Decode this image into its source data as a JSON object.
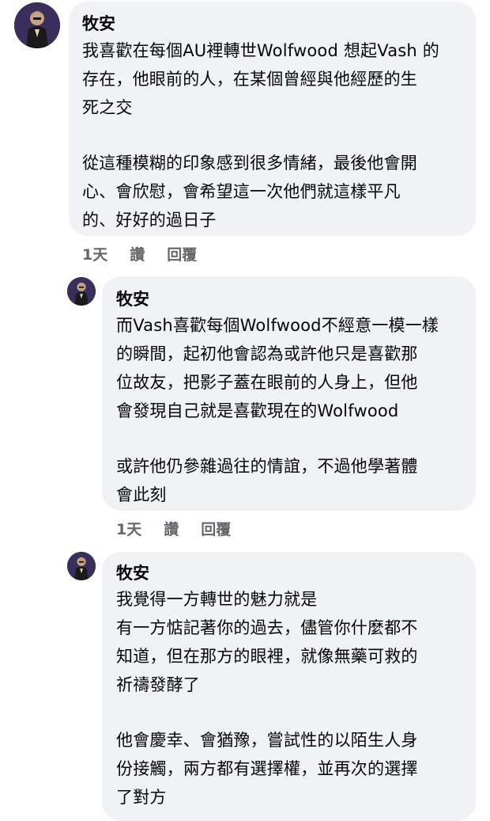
{
  "comments": [
    {
      "author": "牧安",
      "paragraphs": [
        [
          "我喜歡在每個AU裡轉世Wolfwood 想起Vash 的",
          "存在，他眼前的人，在某個曾經與他經歷的生",
          "死之交"
        ],
        [
          "從這種模糊的印象感到很多情緒，最後他會開",
          "心、會欣慰，會希望這一次他們就這樣平凡",
          "的、好好的過日子"
        ]
      ],
      "time": "1天",
      "like": "讚",
      "reply": "回覆"
    },
    {
      "author": "牧安",
      "paragraphs": [
        [
          "而Vash喜歡每個Wolfwood不經意一模一樣",
          "的瞬間，起初他會認為或許他只是喜歡那",
          "位故友，把影子蓋在眼前的人身上，但他",
          "會發現自己就是喜歡現在的Wolfwood"
        ],
        [
          "或許他仍參雜過往的情誼，不過他學著體",
          "會此刻"
        ]
      ],
      "time": "1天",
      "like": "讚",
      "reply": "回覆"
    },
    {
      "author": "牧安",
      "paragraphs": [
        [
          "我覺得一方轉世的魅力就是",
          "有一方惦記著你的過去，儘管你什麼都不",
          "知道，但在那方的眼裡，就像無藥可救的",
          "祈禱發酵了"
        ],
        [
          "他會慶幸、會猶豫，嘗試性的以陌生人身",
          "份接觸，兩方都有選擇權，並再次的選擇",
          "了對方"
        ]
      ]
    }
  ]
}
